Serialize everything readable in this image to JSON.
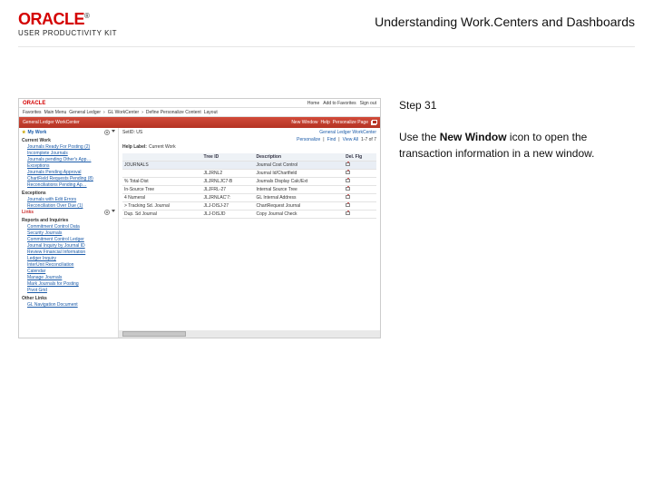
{
  "brand": {
    "logo": "ORACLE",
    "sublogo": "USER PRODUCTIVITY KIT"
  },
  "doc_title": "Understanding Work.Centers and Dashboards",
  "instruction": {
    "step_label": "Step 31",
    "text_before": "Use the ",
    "bold": "New Window",
    "text_after": " icon to open the transaction information in a new window."
  },
  "shot": {
    "topbar_right": [
      "Home",
      "Add to Favorites",
      "Sign out"
    ],
    "nav": [
      "Favorites",
      "Main Menu",
      "General Ledger",
      "GL WorkCenter",
      "Define Personalize Content",
      "Layout"
    ],
    "redbar_title": "General Ledger WorkCenter",
    "redbar_links": [
      "New Window",
      "Help",
      "Personalize Page"
    ],
    "side_tab": "My Work",
    "side_sections": [
      {
        "title": "Current Work",
        "links": [
          "Journals Ready For Posting (2)",
          "Incomplete Journals",
          "Journals pending Other's App…",
          "Exceptions",
          "Journals Pending Approval",
          "ChartField Requests Pending (8)",
          "Reconciliations Pending Ap…"
        ]
      },
      {
        "title": "Exceptions",
        "links": [
          "Journals with Edit Errors",
          "Reconciliation Over Due (1)"
        ]
      }
    ],
    "links_label": "Links",
    "links_sections": [
      {
        "title": "Reports and Inquiries",
        "links": [
          "Commitment Control Data",
          "Security Journals",
          "Commitment Control Ledger",
          "Journal Inquiry by Journal ID",
          "Review Financial Information",
          "Ledger Inquiry",
          "InterUnit Reconciliation",
          "Calendar",
          "Manage Journals",
          "Mark Journals for Posting",
          "Pivot Grid"
        ]
      },
      {
        "title": "Other Links",
        "links": [
          "GL Navigation Document"
        ]
      }
    ],
    "main_crumb_left": "SetID: US",
    "main_crumb_right": "General Ledger WorkCenter",
    "main_toolbar": [
      "Personalize",
      "Find",
      "View All"
    ],
    "main_count": "1-7 of 7",
    "help_label": "Help Label:",
    "help_value": "Current Work",
    "table": {
      "headers": [
        "",
        "Tree ID",
        "Description",
        "Del. Flg"
      ],
      "rows": [
        [
          "JOURNALS",
          "",
          "Journal Cost Control",
          ""
        ],
        [
          "",
          "JLJRNL2",
          "Journal Id/Chartfield",
          ""
        ],
        [
          "% Total-Dist",
          "JLJRNLJC7-B",
          "Journals Display Calc/Ext",
          ""
        ],
        [
          "In-Source Tree",
          "JLJFRL-27",
          "Internal Source Tree",
          ""
        ],
        [
          "4 Numeral",
          "JLJRNLAC'7:",
          "GL Internal Address",
          ""
        ],
        [
          "> Tracking Sd. Journal",
          "JLJ-DISJ-27",
          "ChartRequest Journal",
          ""
        ],
        [
          "Dup. Sd Journal",
          "JLJ-DISJD",
          "Copy Journal Check",
          ""
        ]
      ]
    }
  }
}
